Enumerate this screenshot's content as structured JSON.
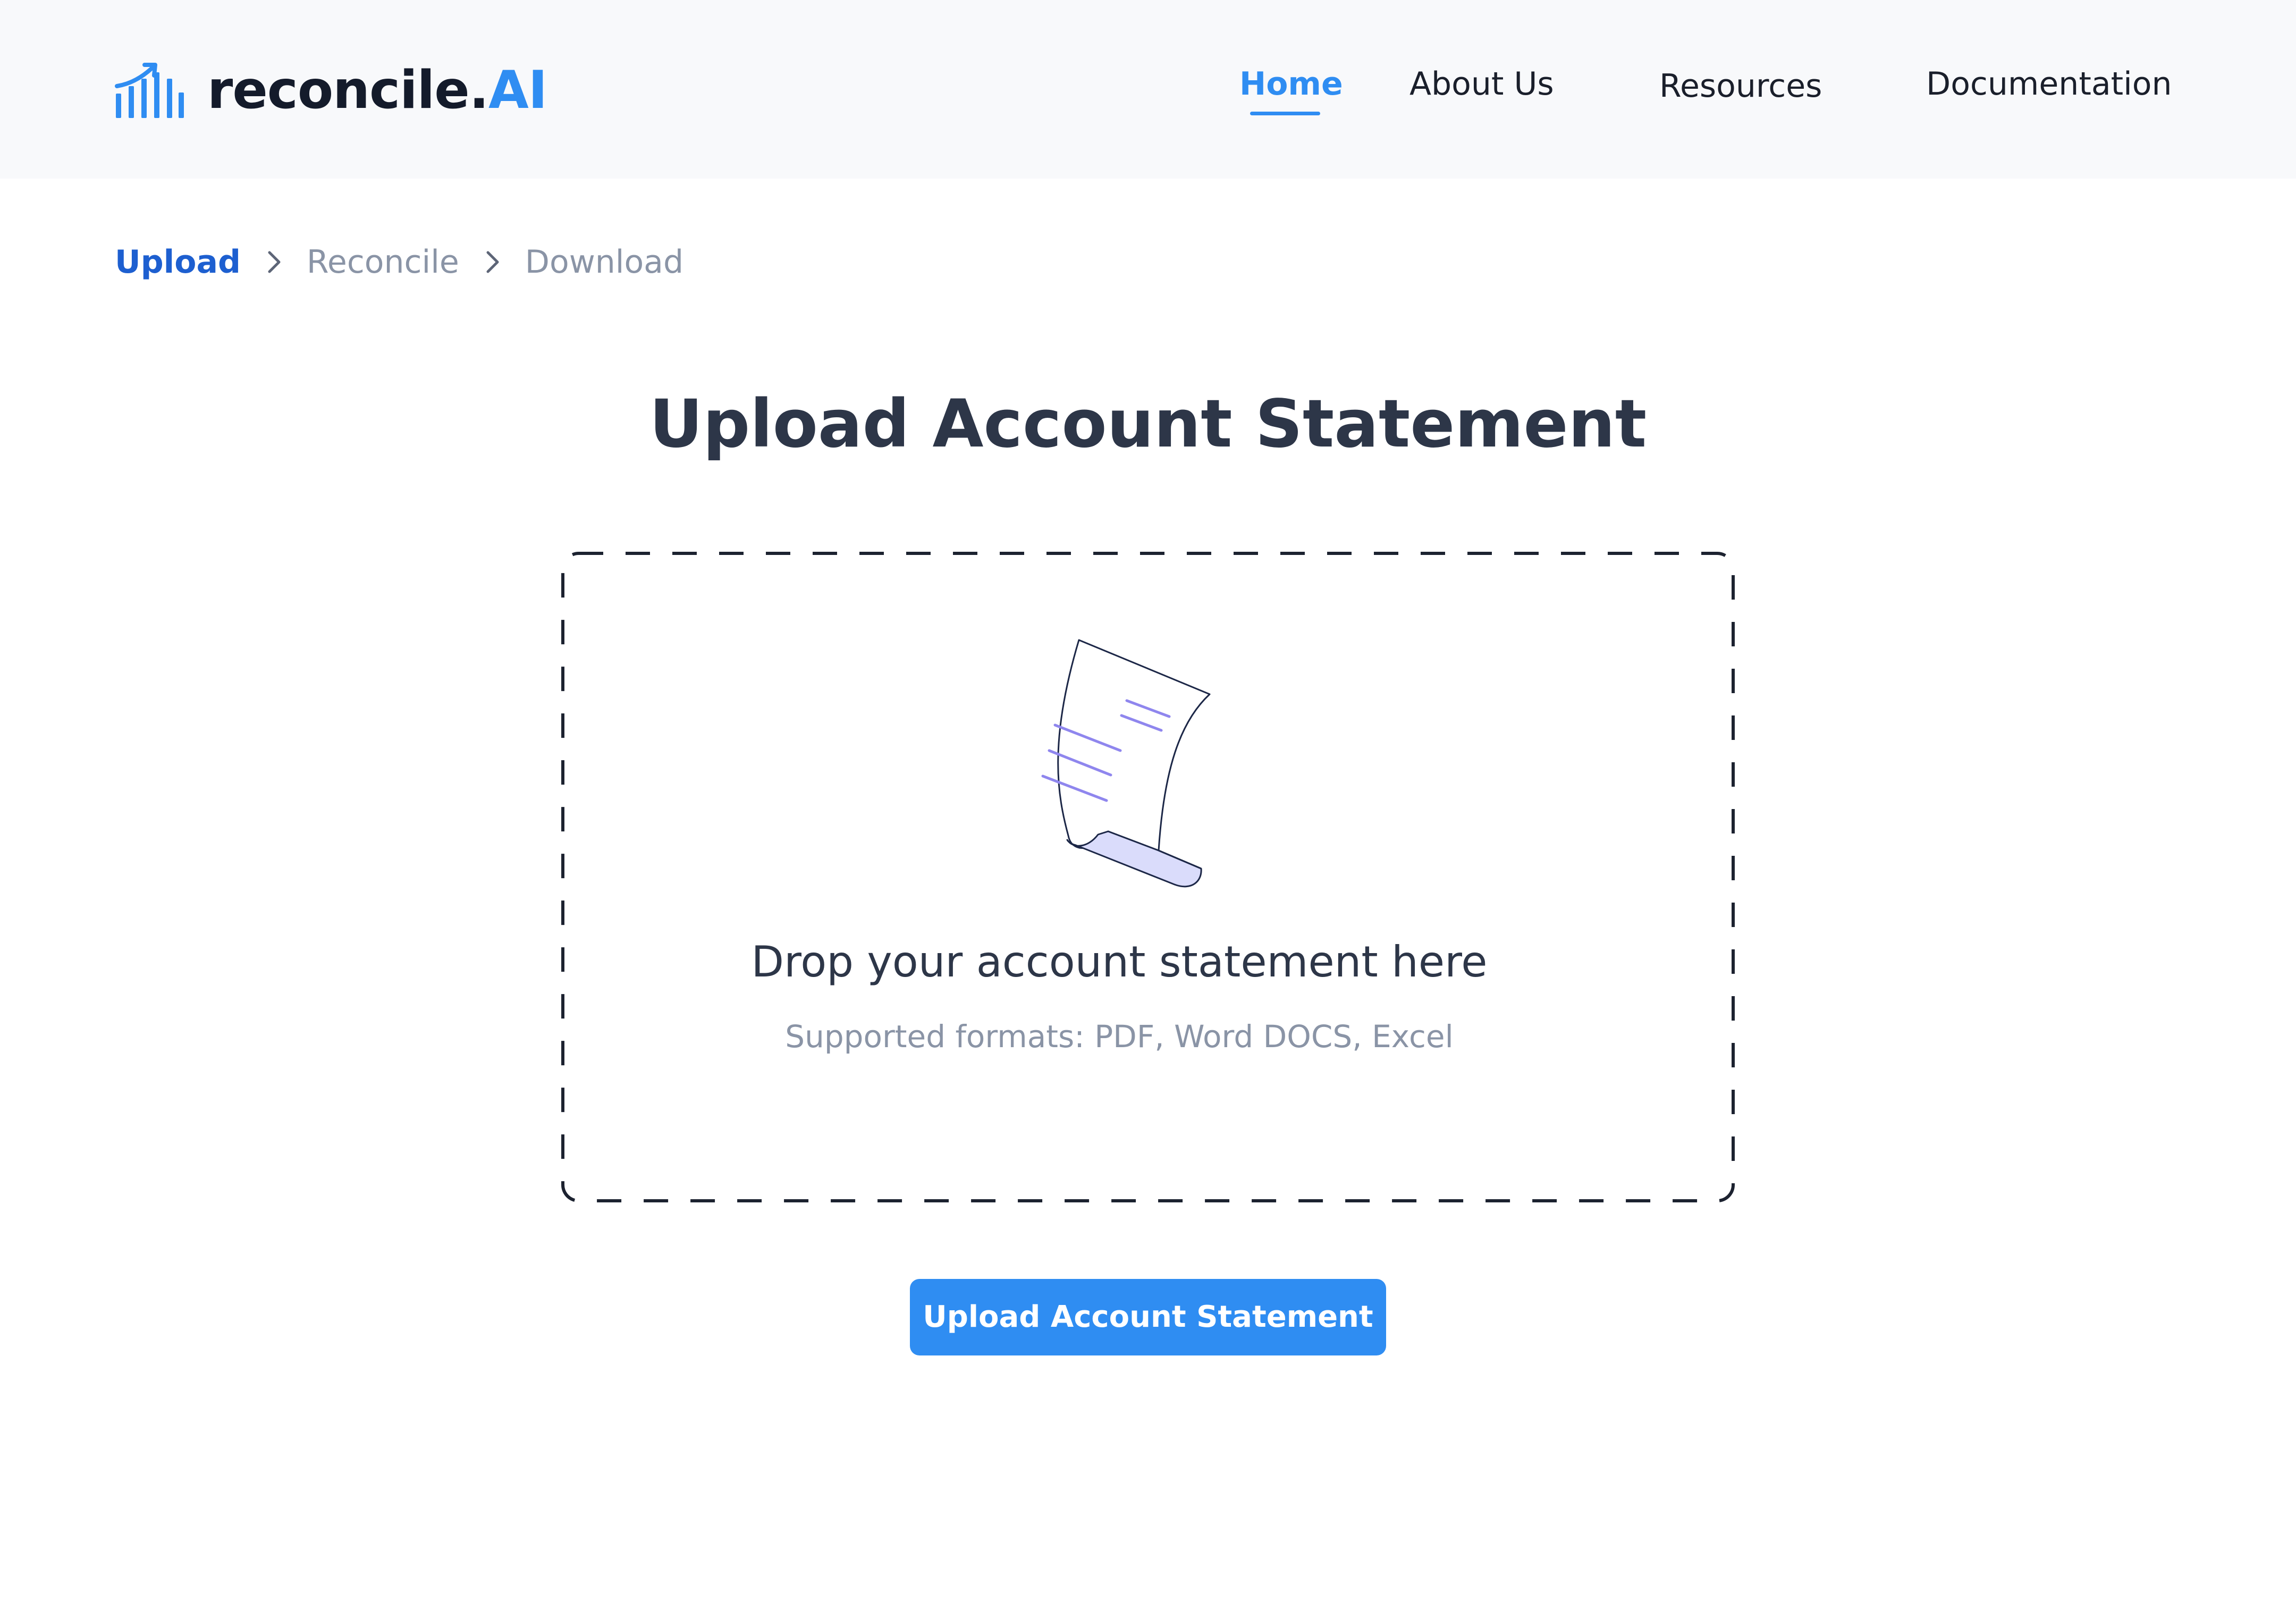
{
  "header": {
    "logo": {
      "text_main": "reconcile.",
      "text_accent": "AI",
      "icon": "bar-chart-trend-icon",
      "accent_color": "#2f8df2"
    },
    "nav": [
      {
        "label": "Home",
        "active": true
      },
      {
        "label": "About Us",
        "active": false
      },
      {
        "label": "Resources",
        "active": false
      },
      {
        "label": "Documentation",
        "active": false
      }
    ]
  },
  "breadcrumb": {
    "steps": [
      {
        "label": "Upload",
        "active": true
      },
      {
        "label": "Reconcile",
        "active": false
      },
      {
        "label": "Download",
        "active": false
      }
    ],
    "separator_icon": "chevron-right-icon"
  },
  "main": {
    "title": "Upload Account Statement",
    "dropzone": {
      "icon": "document-scroll-icon",
      "title": "Drop your account statement here",
      "subtitle": "Supported formats: PDF, Word DOCS, Excel"
    },
    "upload_button_label": "Upload Account Statement"
  },
  "colors": {
    "primary": "#2f8df2",
    "breadcrumb_active": "#1d5fd0",
    "heading": "#2d3648",
    "muted": "#8a94a6",
    "header_bg": "#f8f9fb"
  }
}
